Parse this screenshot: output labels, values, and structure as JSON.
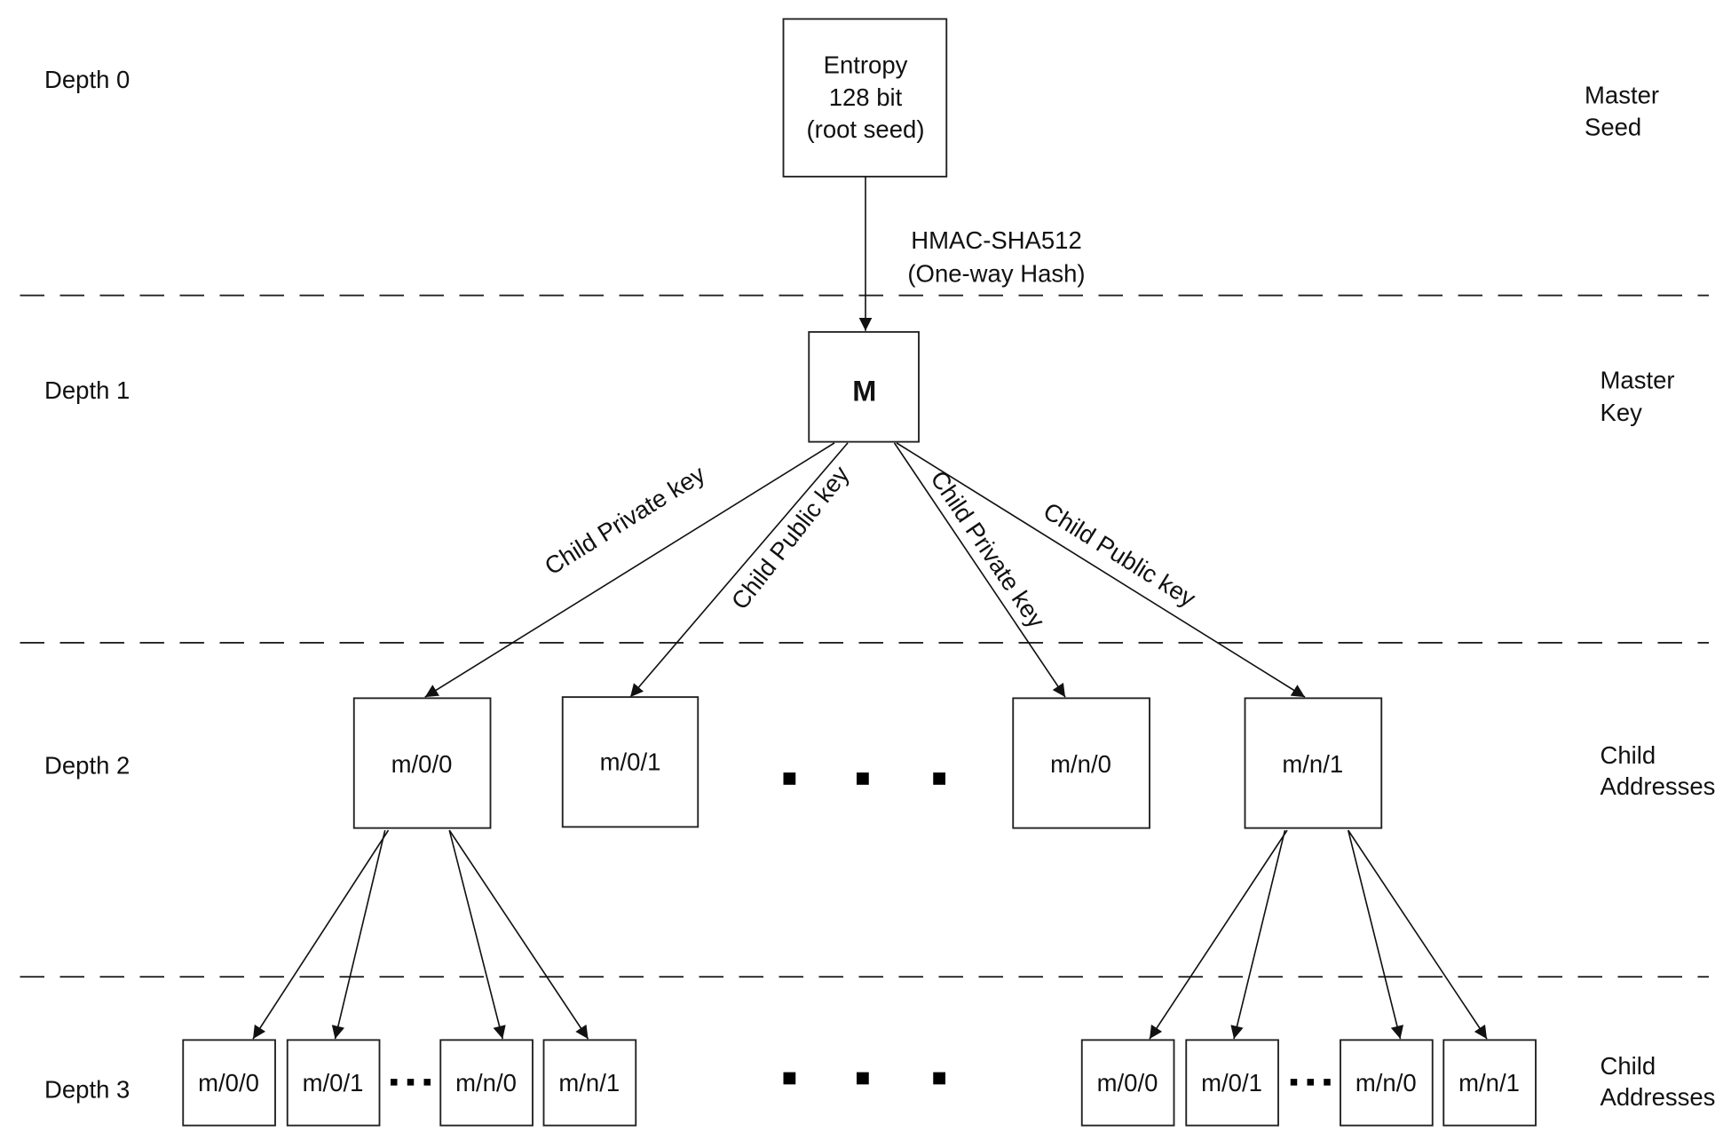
{
  "depth_labels": [
    "Depth 0",
    "Depth 1",
    "Depth 2",
    "Depth 3"
  ],
  "level_labels": {
    "master_seed": [
      "Master",
      "Seed"
    ],
    "master_key": [
      "Master",
      "Key"
    ],
    "child_addresses_2": [
      "Child",
      "Addresses"
    ],
    "child_addresses_3": [
      "Child",
      "Addresses"
    ]
  },
  "root": {
    "lines": [
      "Entropy",
      "128 bit",
      "(root seed)"
    ]
  },
  "hash": {
    "lines": [
      "HMAC-SHA512",
      "(One-way Hash)"
    ]
  },
  "master": {
    "label": "M"
  },
  "edge_labels": {
    "left_private": "Child Private key",
    "left_public": "Child Public key",
    "right_private": "Child Private key",
    "right_public": "Child Public key"
  },
  "depth2": [
    "m/0/0",
    "m/0/1",
    "m/n/0",
    "m/n/1"
  ],
  "depth3_left": [
    "m/0/0",
    "m/0/1",
    "m/n/0",
    "m/n/1"
  ],
  "depth3_right": [
    "m/0/0",
    "m/0/1",
    "m/n/0",
    "m/n/1"
  ]
}
